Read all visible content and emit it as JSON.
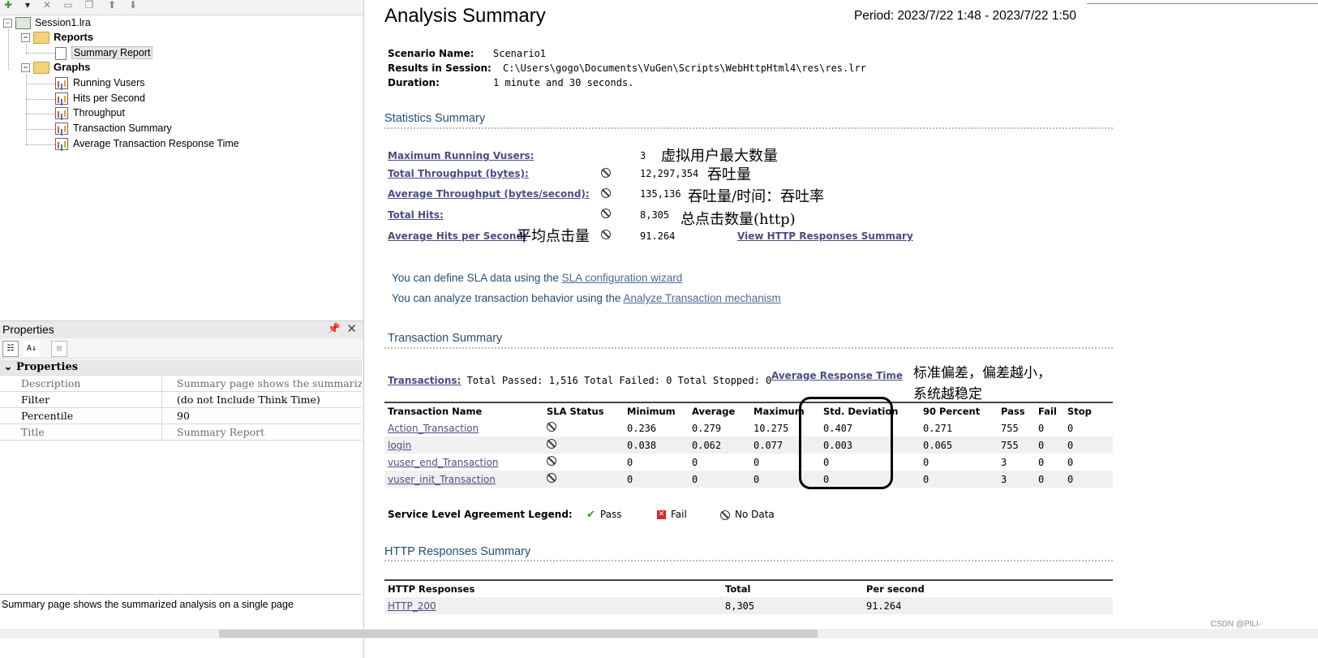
{
  "tree": {
    "session": "Session1.lra",
    "reports_folder": "Reports",
    "summary_report": "Summary Report",
    "graphs_folder": "Graphs",
    "graph_items": [
      "Running Vusers",
      "Hits per Second",
      "Throughput",
      "Transaction Summary",
      "Average Transaction Response Time"
    ]
  },
  "properties": {
    "title": "Properties",
    "category": "Properties",
    "rows": [
      {
        "key": "Description",
        "value": "Summary page shows the summariz"
      },
      {
        "key": "Filter",
        "value": "(do not Include Think Time)"
      },
      {
        "key": "Percentile",
        "value": "90"
      },
      {
        "key": "Title",
        "value": "Summary Report"
      }
    ],
    "description": "Summary page shows the summarized analysis on a single page"
  },
  "report": {
    "title": "Analysis Summary",
    "period": "Period: 2023/7/22 1:48 - 2023/7/22 1:50",
    "meta": {
      "scenario_label": "Scenario Name:",
      "scenario": "Scenario1",
      "results_label": "Results in Session:",
      "results": "C:\\Users\\gogo\\Documents\\VuGen\\Scripts\\WebHttpHtml4\\res\\res.lrr",
      "duration_label": "Duration:",
      "duration": "1 minute and 30 seconds."
    },
    "stats_heading": "Statistics Summary",
    "stats": [
      {
        "label": "Maximum Running Vusers:",
        "value": "3",
        "note": "虚拟用户最大数量"
      },
      {
        "label": "Total Throughput (bytes):",
        "value": "12,297,354",
        "note": "吞吐量"
      },
      {
        "label": "Average Throughput (bytes/second):",
        "value": "135,136",
        "note": "吞吐量/时间：吞吐率"
      },
      {
        "label": "Total Hits:",
        "value": "8,305",
        "note": "总点击数量(http)"
      },
      {
        "label": "Average Hits per Second:",
        "value": "91.264",
        "note": "平均点击量"
      }
    ],
    "view_http_link": "View HTTP Responses Summary",
    "sla_line1_prefix": "You can define SLA data using the ",
    "sla_line1_link": "SLA configuration wizard",
    "sla_line2_prefix": "You can analyze transaction behavior using the ",
    "sla_line2_link": "Analyze Transaction mechanism",
    "tx_heading": "Transaction Summary",
    "tx_link": "Transactions:",
    "tx_totals": " Total Passed: 1,516 Total Failed: 0 Total Stopped: 0",
    "avg_resp_link": "Average Response Time",
    "stddev_note_1": "标准偏差，偏差越小，",
    "stddev_note_2": "系统越稳定",
    "tx_columns": [
      "Transaction Name",
      "SLA Status",
      "Minimum",
      "Average",
      "Maximum",
      "Std. Deviation",
      "90 Percent",
      "Pass",
      "Fail",
      "Stop"
    ],
    "tx_rows": [
      [
        "Action_Transaction",
        "0.236",
        "0.279",
        "10.275",
        "0.407",
        "0.271",
        "755",
        "0",
        "0"
      ],
      [
        "login",
        "0.038",
        "0.062",
        "0.077",
        "0.003",
        "0.065",
        "755",
        "0",
        "0"
      ],
      [
        "vuser_end_Transaction",
        "0",
        "0",
        "0",
        "0",
        "0",
        "3",
        "0",
        "0"
      ],
      [
        "vuser_init_Transaction",
        "0",
        "0",
        "0",
        "0",
        "0",
        "3",
        "0",
        "0"
      ]
    ],
    "legend_label": "Service Level Agreement Legend:",
    "legend_pass": "Pass",
    "legend_fail": "Fail",
    "legend_nodata": "No Data",
    "http_heading": "HTTP Responses Summary",
    "http_columns": [
      "HTTP Responses",
      "Total",
      "Per second"
    ],
    "http_rows": [
      [
        "HTTP_200",
        "8,305",
        "91.264"
      ]
    ]
  },
  "watermark": "CSDN @PILI-"
}
